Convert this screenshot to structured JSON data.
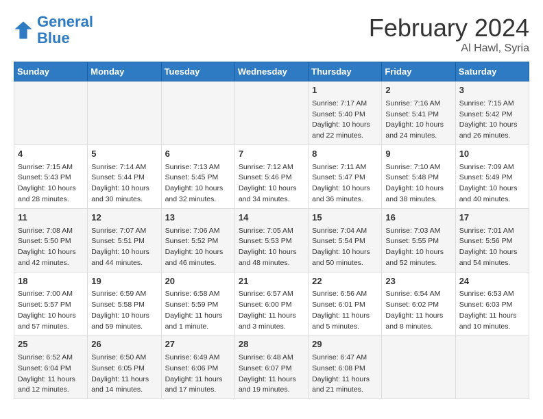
{
  "header": {
    "logo_line1": "General",
    "logo_line2": "Blue",
    "main_title": "February 2024",
    "sub_title": "Al Hawl, Syria"
  },
  "weekdays": [
    "Sunday",
    "Monday",
    "Tuesday",
    "Wednesday",
    "Thursday",
    "Friday",
    "Saturday"
  ],
  "rows": [
    [
      {
        "day": "",
        "info": ""
      },
      {
        "day": "",
        "info": ""
      },
      {
        "day": "",
        "info": ""
      },
      {
        "day": "",
        "info": ""
      },
      {
        "day": "1",
        "info": "Sunrise: 7:17 AM\nSunset: 5:40 PM\nDaylight: 10 hours\nand 22 minutes."
      },
      {
        "day": "2",
        "info": "Sunrise: 7:16 AM\nSunset: 5:41 PM\nDaylight: 10 hours\nand 24 minutes."
      },
      {
        "day": "3",
        "info": "Sunrise: 7:15 AM\nSunset: 5:42 PM\nDaylight: 10 hours\nand 26 minutes."
      }
    ],
    [
      {
        "day": "4",
        "info": "Sunrise: 7:15 AM\nSunset: 5:43 PM\nDaylight: 10 hours\nand 28 minutes."
      },
      {
        "day": "5",
        "info": "Sunrise: 7:14 AM\nSunset: 5:44 PM\nDaylight: 10 hours\nand 30 minutes."
      },
      {
        "day": "6",
        "info": "Sunrise: 7:13 AM\nSunset: 5:45 PM\nDaylight: 10 hours\nand 32 minutes."
      },
      {
        "day": "7",
        "info": "Sunrise: 7:12 AM\nSunset: 5:46 PM\nDaylight: 10 hours\nand 34 minutes."
      },
      {
        "day": "8",
        "info": "Sunrise: 7:11 AM\nSunset: 5:47 PM\nDaylight: 10 hours\nand 36 minutes."
      },
      {
        "day": "9",
        "info": "Sunrise: 7:10 AM\nSunset: 5:48 PM\nDaylight: 10 hours\nand 38 minutes."
      },
      {
        "day": "10",
        "info": "Sunrise: 7:09 AM\nSunset: 5:49 PM\nDaylight: 10 hours\nand 40 minutes."
      }
    ],
    [
      {
        "day": "11",
        "info": "Sunrise: 7:08 AM\nSunset: 5:50 PM\nDaylight: 10 hours\nand 42 minutes."
      },
      {
        "day": "12",
        "info": "Sunrise: 7:07 AM\nSunset: 5:51 PM\nDaylight: 10 hours\nand 44 minutes."
      },
      {
        "day": "13",
        "info": "Sunrise: 7:06 AM\nSunset: 5:52 PM\nDaylight: 10 hours\nand 46 minutes."
      },
      {
        "day": "14",
        "info": "Sunrise: 7:05 AM\nSunset: 5:53 PM\nDaylight: 10 hours\nand 48 minutes."
      },
      {
        "day": "15",
        "info": "Sunrise: 7:04 AM\nSunset: 5:54 PM\nDaylight: 10 hours\nand 50 minutes."
      },
      {
        "day": "16",
        "info": "Sunrise: 7:03 AM\nSunset: 5:55 PM\nDaylight: 10 hours\nand 52 minutes."
      },
      {
        "day": "17",
        "info": "Sunrise: 7:01 AM\nSunset: 5:56 PM\nDaylight: 10 hours\nand 54 minutes."
      }
    ],
    [
      {
        "day": "18",
        "info": "Sunrise: 7:00 AM\nSunset: 5:57 PM\nDaylight: 10 hours\nand 57 minutes."
      },
      {
        "day": "19",
        "info": "Sunrise: 6:59 AM\nSunset: 5:58 PM\nDaylight: 10 hours\nand 59 minutes."
      },
      {
        "day": "20",
        "info": "Sunrise: 6:58 AM\nSunset: 5:59 PM\nDaylight: 11 hours\nand 1 minute."
      },
      {
        "day": "21",
        "info": "Sunrise: 6:57 AM\nSunset: 6:00 PM\nDaylight: 11 hours\nand 3 minutes."
      },
      {
        "day": "22",
        "info": "Sunrise: 6:56 AM\nSunset: 6:01 PM\nDaylight: 11 hours\nand 5 minutes."
      },
      {
        "day": "23",
        "info": "Sunrise: 6:54 AM\nSunset: 6:02 PM\nDaylight: 11 hours\nand 8 minutes."
      },
      {
        "day": "24",
        "info": "Sunrise: 6:53 AM\nSunset: 6:03 PM\nDaylight: 11 hours\nand 10 minutes."
      }
    ],
    [
      {
        "day": "25",
        "info": "Sunrise: 6:52 AM\nSunset: 6:04 PM\nDaylight: 11 hours\nand 12 minutes."
      },
      {
        "day": "26",
        "info": "Sunrise: 6:50 AM\nSunset: 6:05 PM\nDaylight: 11 hours\nand 14 minutes."
      },
      {
        "day": "27",
        "info": "Sunrise: 6:49 AM\nSunset: 6:06 PM\nDaylight: 11 hours\nand 17 minutes."
      },
      {
        "day": "28",
        "info": "Sunrise: 6:48 AM\nSunset: 6:07 PM\nDaylight: 11 hours\nand 19 minutes."
      },
      {
        "day": "29",
        "info": "Sunrise: 6:47 AM\nSunset: 6:08 PM\nDaylight: 11 hours\nand 21 minutes."
      },
      {
        "day": "",
        "info": ""
      },
      {
        "day": "",
        "info": ""
      }
    ]
  ]
}
